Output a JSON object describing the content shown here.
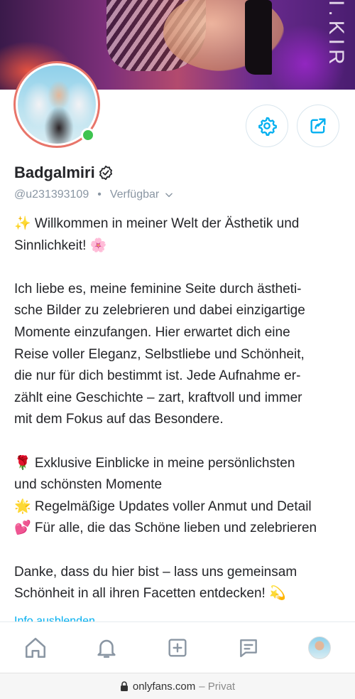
{
  "cover": {
    "brand_text": "I.KIR"
  },
  "profile": {
    "name": "Badgalmiri",
    "handle": "@u231393109",
    "status": "Verfügbar",
    "online": true
  },
  "bio": {
    "lines": [
      "✨ Willkommen in meiner Welt der Ästhetik und",
      "Sinnlichkeit! 🌸",
      "",
      "Ich liebe es, meine feminine Seite durch ästheti-",
      "sche Bilder zu zelebrieren und dabei einzigartige",
      "Momente einzufangen. Hier erwartet dich eine",
      "Reise voller Eleganz, Selbstliebe und Schönheit,",
      "die nur für dich bestimmt ist. Jede Aufnahme er-",
      "zählt eine Geschichte – zart, kraftvoll und immer",
      "mit dem Fokus auf das Besondere.",
      "",
      "🌹 Exklusive Einblicke in meine persönlichsten",
      "und schönsten Momente",
      "🌟 Regelmäßige Updates voller Anmut und Detail",
      "💕 Für alle, die das Schöne lieben und zelebrieren",
      "",
      "Danke, dass du hier bist – lass uns gemeinsam",
      "Schönheit in all ihren Facetten entdecken! 💫"
    ],
    "toggle_label": "Info ausblenden"
  },
  "actions": {
    "settings_icon": "gear-icon",
    "share_icon": "share-icon"
  },
  "tabbar": {
    "items": [
      "home-icon",
      "bell-icon",
      "plus-square-icon",
      "message-icon",
      "profile-avatar"
    ]
  },
  "browser": {
    "domain": "onlyfans.com",
    "mode": "– Privat"
  },
  "colors": {
    "accent": "#00aff0",
    "online": "#3ec34f",
    "avatar_ring": "#e8756a",
    "muted": "#8a96a3"
  }
}
